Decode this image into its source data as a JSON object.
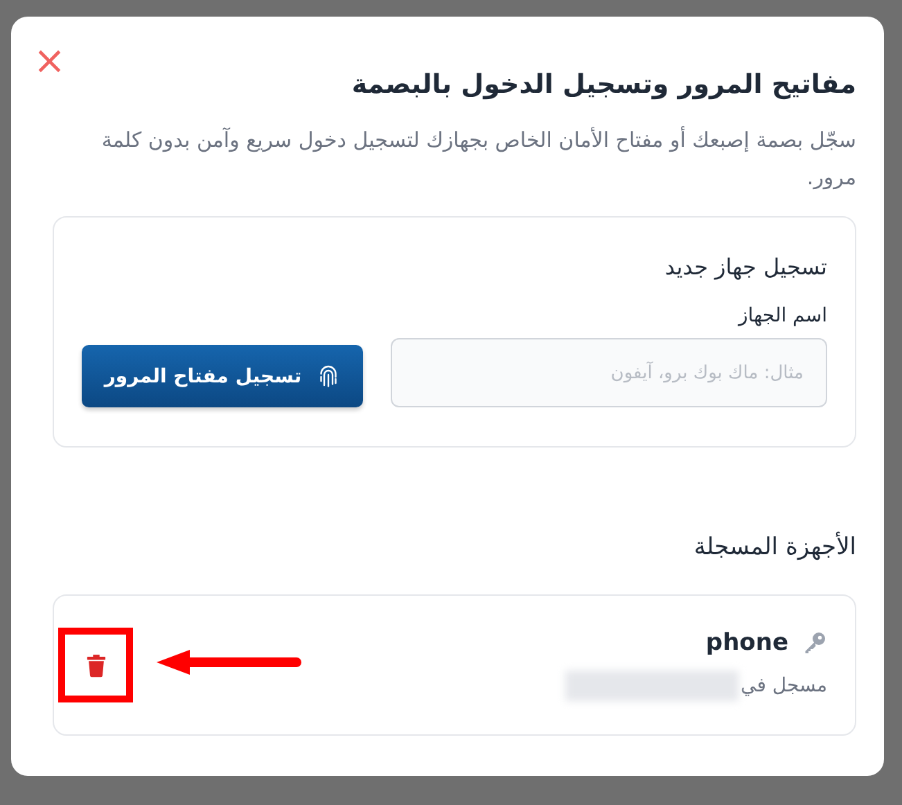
{
  "dialog": {
    "close": "×",
    "title": "مفاتيح المرور وتسجيل الدخول بالبصمة",
    "description": "سجّل بصمة إصبعك أو مفتاح الأمان الخاص بجهازك لتسجيل دخول سريع وآمن بدون كلمة مرور."
  },
  "register": {
    "title": "تسجيل جهاز جديد",
    "label": "اسم الجهاز",
    "placeholder": "مثال: ماك بوك برو، آيفون",
    "button": "تسجيل مفتاح المرور"
  },
  "devices": {
    "title": "الأجهزة المسجلة",
    "items": [
      {
        "name": "phone",
        "registered": "مسجل في",
        "redacted": true,
        "highlighted": true
      }
    ]
  }
}
